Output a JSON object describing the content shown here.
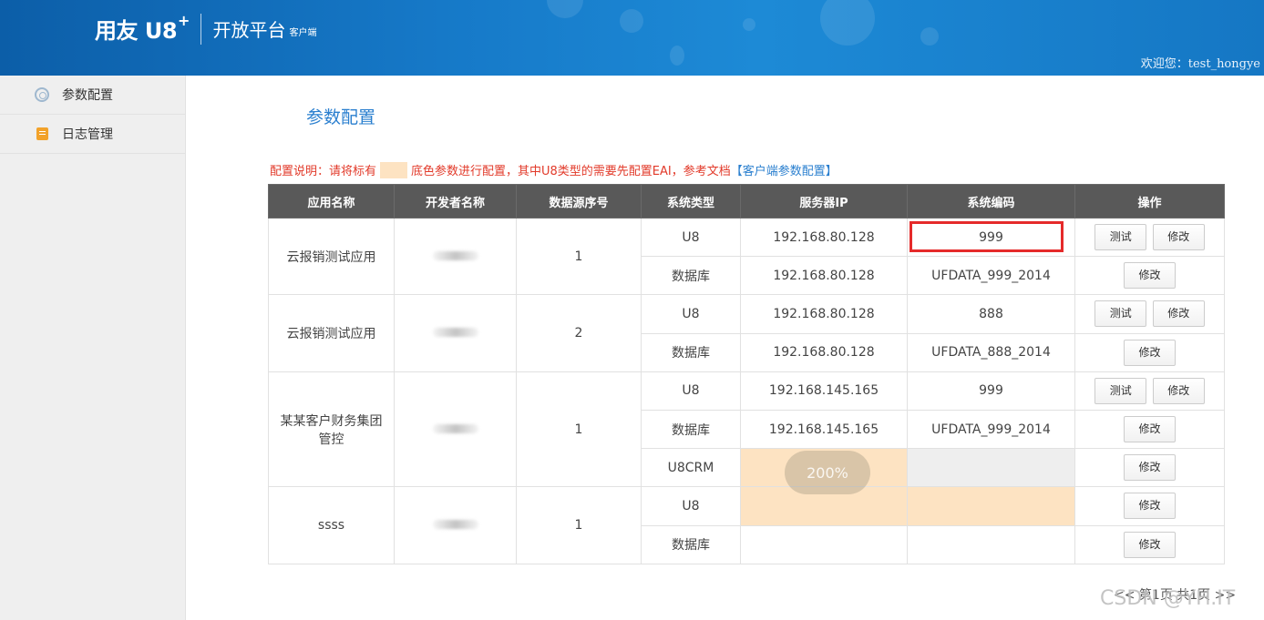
{
  "header": {
    "logo_main": "用友 U8",
    "logo_plus": "+",
    "platform": "开放平台",
    "edition": "客户端",
    "welcome": "欢迎您：test_hongye"
  },
  "sidebar": {
    "items": [
      {
        "label": "参数配置",
        "icon": "gear-icon"
      },
      {
        "label": "日志管理",
        "icon": "log-icon"
      }
    ]
  },
  "main": {
    "title": "参数配置",
    "notice_prefix": "配置说明：请将标有",
    "notice_middle": "底色参数进行配置，其中U8类型的需要先配置EAI，参考文档",
    "notice_link": "【客户端参数配置】",
    "highlight_color": "#fde3c2"
  },
  "table": {
    "headers": [
      "应用名称",
      "开发者名称",
      "数据源序号",
      "系统类型",
      "服务器IP",
      "系统编码",
      "操作"
    ],
    "groups": [
      {
        "app": "云报销测试应用",
        "seq": "1",
        "rows": [
          {
            "type": "U8",
            "ip": "192.168.80.128",
            "code": "999",
            "actions": [
              "测试",
              "修改"
            ]
          },
          {
            "type": "数据库",
            "ip": "192.168.80.128",
            "code": "UFDATA_999_2014",
            "actions": [
              "修改"
            ]
          }
        ]
      },
      {
        "app": "云报销测试应用",
        "seq": "2",
        "rows": [
          {
            "type": "U8",
            "ip": "192.168.80.128",
            "code": "888",
            "actions": [
              "测试",
              "修改"
            ]
          },
          {
            "type": "数据库",
            "ip": "192.168.80.128",
            "code": "UFDATA_888_2014",
            "actions": [
              "修改"
            ]
          }
        ]
      },
      {
        "app": "某某客户财务集团管控",
        "seq": "1",
        "rows": [
          {
            "type": "U8",
            "ip": "192.168.145.165",
            "code": "999",
            "actions": [
              "测试",
              "修改"
            ]
          },
          {
            "type": "数据库",
            "ip": "192.168.145.165",
            "code": "UFDATA_999_2014",
            "actions": [
              "修改"
            ]
          },
          {
            "type": "U8CRM",
            "ip": "",
            "code": "",
            "actions": [
              "修改"
            ]
          }
        ]
      },
      {
        "app": "ssss",
        "seq": "1",
        "rows": [
          {
            "type": "U8",
            "ip": "",
            "code": "",
            "actions": [
              "修改"
            ]
          },
          {
            "type": "数据库",
            "ip": "",
            "code": "",
            "actions": [
              "修改"
            ]
          }
        ]
      }
    ]
  },
  "overlay": {
    "zoom": "200%"
  },
  "pager": {
    "text": "<< 第1页 共1页 >>"
  },
  "watermark": "CSDN @YH.IT"
}
